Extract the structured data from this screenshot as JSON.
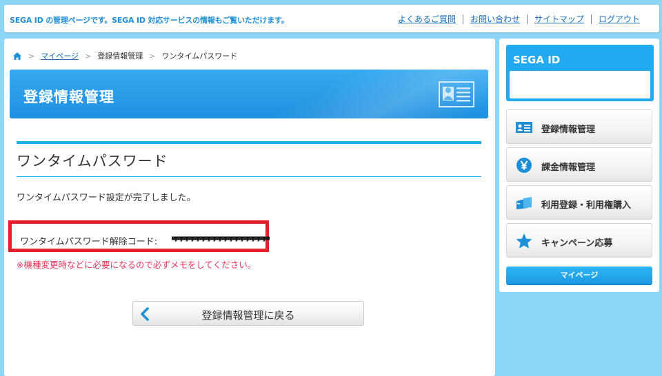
{
  "header": {
    "notice": "SEGA ID の管理ページです。SEGA ID 対応サービスの情報もご覧いただけます。",
    "links": [
      "よくあるご質問",
      "お問い合わせ",
      "サイトマップ",
      "ログアウト"
    ]
  },
  "breadcrumb": {
    "home_icon": "home-icon",
    "items": [
      "マイページ",
      "登録情報管理",
      "ワンタイムパスワード"
    ]
  },
  "banner": {
    "title": "登録情報管理",
    "icon": "id-card-icon"
  },
  "section": {
    "title": "ワンタイムパスワード",
    "complete_message": "ワンタイムパスワード設定が完了しました。",
    "code_label": "ワンタイムパスワード解除コード: ",
    "warning": "※機種変更時などに必要になるので必ずメモをしてください。"
  },
  "back_button": {
    "label": "登録情報管理に戻る",
    "icon": "chevron-left-icon"
  },
  "sidebar": {
    "header": "SEGA ID",
    "items": [
      {
        "label": "登録情報管理",
        "icon": "id-card-icon"
      },
      {
        "label": "課金情報管理",
        "icon": "yen-icon"
      },
      {
        "label": "利用登録・利用権購入",
        "icon": "ticket-icon"
      },
      {
        "label": "キャンペーン応募",
        "icon": "star-icon"
      }
    ],
    "mypage_button": "マイページ"
  },
  "colors": {
    "accent": "#1eabe6",
    "warning": "#e8315a",
    "highlight_border": "#e6202b",
    "page_bg": "#8cd6f7"
  }
}
